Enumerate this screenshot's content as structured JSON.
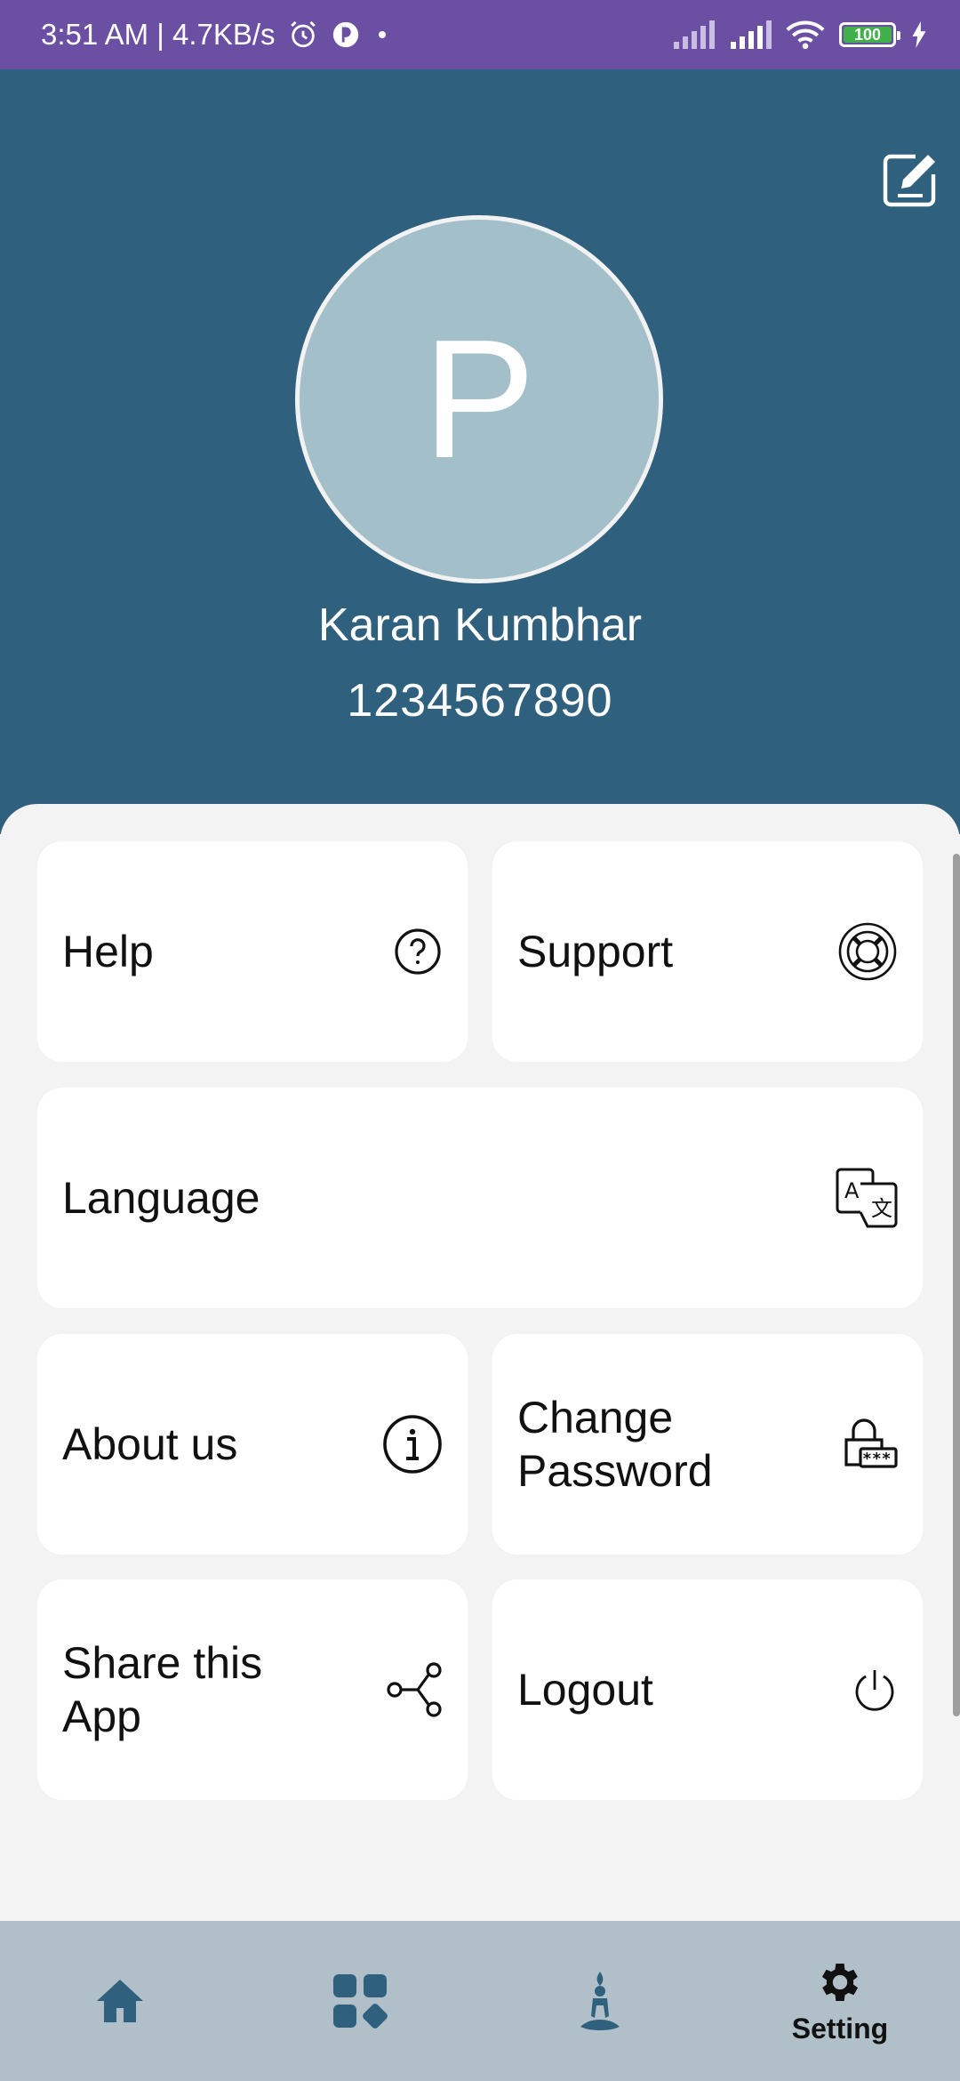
{
  "status_bar": {
    "time_speed": "3:51 AM | 4.7KB/s",
    "battery": "100"
  },
  "profile": {
    "avatar_letter": "P",
    "name": "Karan Kumbhar",
    "phone": "1234567890"
  },
  "menu": {
    "help": "Help",
    "support": "Support",
    "language": "Language",
    "about": "About us",
    "change_password": "Change Password",
    "share": "Share this App",
    "logout": "Logout"
  },
  "nav": {
    "setting_label": "Setting"
  },
  "colors": {
    "status_bar": "#6a4fa3",
    "header": "#2f617f",
    "avatar": "#a3bfca",
    "bottom_nav": "#b0bfc8",
    "nav_icon": "#2f617f"
  }
}
